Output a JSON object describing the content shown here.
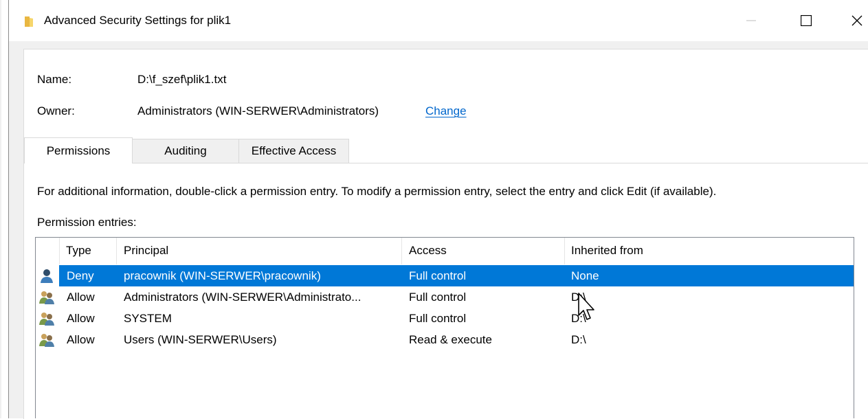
{
  "window": {
    "title": "Advanced Security Settings for plik1",
    "icon": "folder-icon",
    "controls": [
      "minimize-icon",
      "maximize-icon",
      "close-icon"
    ]
  },
  "info": {
    "name_label": "Name:",
    "name_value": "D:\\f_szef\\plik1.txt",
    "owner_label": "Owner:",
    "owner_value": "Administrators (WIN-SERWER\\Administrators)",
    "change_link": "Change"
  },
  "tabs": [
    {
      "label": "Permissions",
      "active": true
    },
    {
      "label": "Auditing",
      "active": false
    },
    {
      "label": "Effective Access",
      "active": false
    }
  ],
  "instructions": "For additional information, double-click a permission entry. To modify a permission entry, select the entry and click Edit (if available).",
  "entries_label": "Permission entries:",
  "table": {
    "columns": [
      "Type",
      "Principal",
      "Access",
      "Inherited from"
    ],
    "rows": [
      {
        "icon": "user-icon",
        "type": "Deny",
        "principal": "pracownik (WIN-SERWER\\pracownik)",
        "access": "Full control",
        "inherited": "None",
        "selected": true
      },
      {
        "icon": "group-icon",
        "type": "Allow",
        "principal": "Administrators (WIN-SERWER\\Administrato...",
        "access": "Full control",
        "inherited": "D:\\",
        "selected": false
      },
      {
        "icon": "group-icon",
        "type": "Allow",
        "principal": "SYSTEM",
        "access": "Full control",
        "inherited": "D:\\",
        "selected": false
      },
      {
        "icon": "group-icon",
        "type": "Allow",
        "principal": "Users (WIN-SERWER\\Users)",
        "access": "Read & execute",
        "inherited": "D:\\",
        "selected": false
      }
    ]
  },
  "colors": {
    "selection": "#0078d7",
    "link": "#0066cc",
    "dialog_bg": "#f0f0f0"
  }
}
